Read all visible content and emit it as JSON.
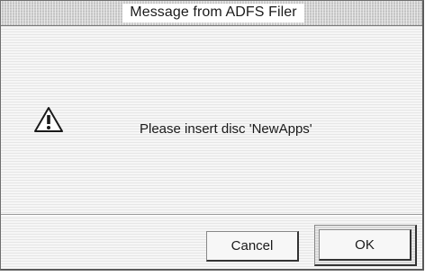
{
  "window": {
    "title": "Message from ADFS Filer"
  },
  "message": {
    "icon": "warning-icon",
    "text": "Please insert disc 'NewApps'"
  },
  "buttons": {
    "cancel_label": "Cancel",
    "ok_label": "OK"
  },
  "colors": {
    "window_background": "#f3f3f3",
    "title_background": "#ffffff",
    "text": "#1a1a1a"
  }
}
